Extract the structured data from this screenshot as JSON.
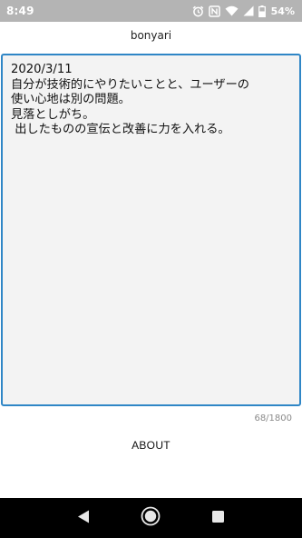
{
  "status_bar": {
    "time": "8:49",
    "battery": "54%",
    "icons": [
      "alarm-icon",
      "nfc-icon",
      "wifi-icon",
      "signal-icon",
      "battery-icon"
    ]
  },
  "app": {
    "title": "bonyari"
  },
  "note": {
    "lines": [
      "2020/3/11",
      "自分が技術的にやりたいことと、ユーザーの",
      "使い心地は別の問題。",
      "見落としがち。",
      " 出したものの宣伝と改善に力を入れる。"
    ],
    "char_count": "68/1800"
  },
  "about_label": "ABOUT",
  "nav": {
    "icons": [
      "back-icon",
      "home-icon",
      "recents-icon"
    ]
  },
  "colors": {
    "status_bar": "#b4b4b4",
    "accent_border": "#2f86c6",
    "note_background": "#f3f3f3",
    "nav_bar": "#000000"
  }
}
